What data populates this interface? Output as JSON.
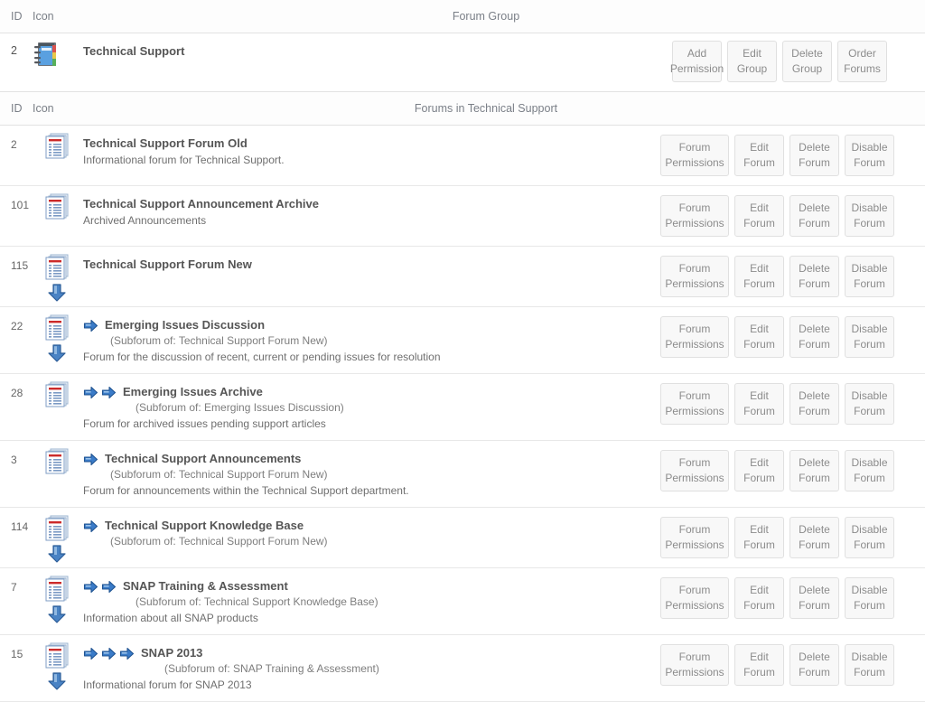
{
  "headers": {
    "group_header": {
      "id": "ID",
      "icon": "Icon",
      "title": "Forum Group"
    },
    "forum_header": {
      "id": "ID",
      "icon": "Icon",
      "title": "Forums in Technical Support"
    }
  },
  "group": {
    "id": "2",
    "name": "Technical Support",
    "icon": "notebook-icon",
    "buttons": [
      {
        "line1": "Add",
        "line2": "Permission",
        "name": "add-permission-button"
      },
      {
        "line1": "Edit",
        "line2": "Group",
        "name": "edit-group-button"
      },
      {
        "line1": "Delete",
        "line2": "Group",
        "name": "delete-group-button"
      },
      {
        "line1": "Order",
        "line2": "Forums",
        "name": "order-forums-button"
      }
    ]
  },
  "forum_buttons": [
    {
      "line1": "Forum",
      "line2": "Permissions",
      "name": "forum-permissions-button",
      "wide": true
    },
    {
      "line1": "Edit",
      "line2": "Forum",
      "name": "edit-forum-button",
      "wide": false
    },
    {
      "line1": "Delete",
      "line2": "Forum",
      "name": "delete-forum-button",
      "wide": false
    },
    {
      "line1": "Disable",
      "line2": "Forum",
      "name": "disable-forum-button",
      "wide": false
    }
  ],
  "forums": [
    {
      "id": "2",
      "title": "Technical Support Forum Old",
      "subforum_of": "",
      "description": "Informational forum for Technical Support.",
      "depth": 0,
      "has_children": false
    },
    {
      "id": "101",
      "title": "Technical Support Announcement Archive",
      "subforum_of": "",
      "description": "Archived Announcements",
      "depth": 0,
      "has_children": false
    },
    {
      "id": "115",
      "title": "Technical Support Forum New",
      "subforum_of": "",
      "description": "",
      "depth": 0,
      "has_children": true
    },
    {
      "id": "22",
      "title": "Emerging Issues Discussion",
      "subforum_of": "(Subforum of: Technical Support Forum New)",
      "description": "Forum for the discussion of recent, current or pending issues for resolution",
      "depth": 1,
      "has_children": true
    },
    {
      "id": "28",
      "title": "Emerging Issues Archive",
      "subforum_of": "(Subforum of: Emerging Issues Discussion)",
      "description": "Forum for archived issues pending support articles",
      "depth": 2,
      "has_children": false
    },
    {
      "id": "3",
      "title": "Technical Support Announcements",
      "subforum_of": "(Subforum of: Technical Support Forum New)",
      "description": "Forum for announcements within the Technical Support department.",
      "depth": 1,
      "has_children": false
    },
    {
      "id": "114",
      "title": "Technical Support Knowledge Base",
      "subforum_of": "(Subforum of: Technical Support Forum New)",
      "description": "",
      "depth": 1,
      "has_children": true
    },
    {
      "id": "7",
      "title": "SNAP Training & Assessment",
      "subforum_of": "(Subforum of: Technical Support Knowledge Base)",
      "description": "Information about all SNAP products",
      "depth": 2,
      "has_children": true
    },
    {
      "id": "15",
      "title": "SNAP 2013",
      "subforum_of": "(Subforum of: SNAP Training & Assessment)",
      "description": "Informational forum for SNAP 2013",
      "depth": 3,
      "has_children": true
    }
  ],
  "colors": {
    "border": "#e2e2e2",
    "button_bg": "#f8f8f8",
    "button_text": "#8c8c8c",
    "title_text": "#555555",
    "header_text": "#7a7f87",
    "icon_blue": "#3a7bc8"
  }
}
